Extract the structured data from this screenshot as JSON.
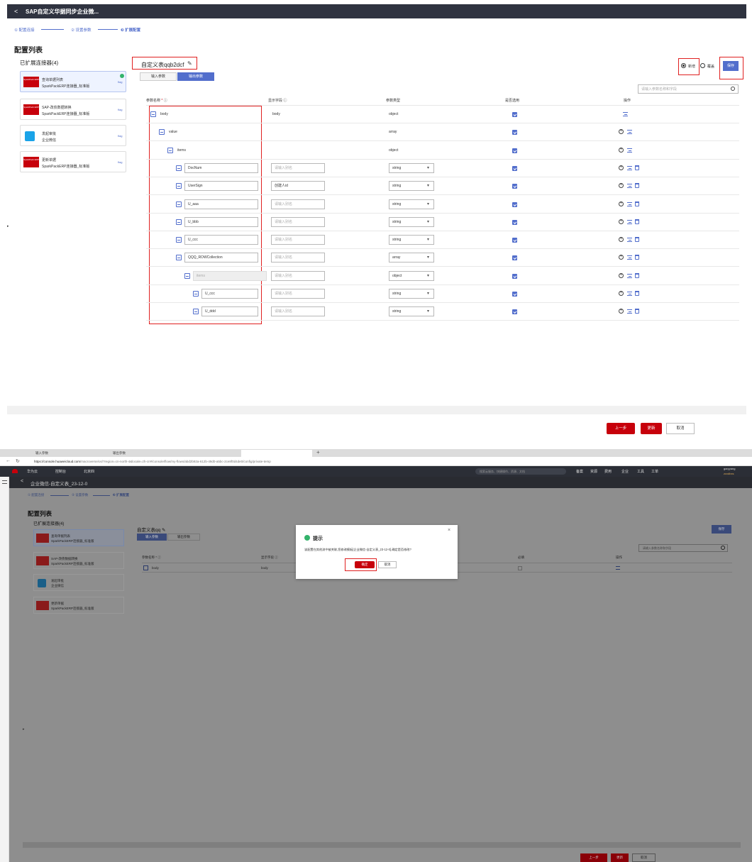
{
  "top": {
    "header": {
      "back": "<",
      "title": "SAP自定义华据同步企业微..."
    },
    "steps": [
      "① 配置连接",
      "② 设置参数",
      "❸ 扩展配置"
    ],
    "section_title": "配置列表",
    "connectors_title": "已扩展连接器(4)",
    "connectors": [
      {
        "name": "查询单据列表",
        "sub": "SparkPackERP连接器_标准版",
        "tag": "flag",
        "logo": "SparkPack ERP"
      },
      {
        "name": "SAP-改债数据转换",
        "sub": "SparkPackERP连接器_标准版",
        "tag": "flag",
        "logo": "SparkPack ERP"
      },
      {
        "name": "发起审批",
        "sub": "企业微信",
        "tag": "flag",
        "logo": ""
      },
      {
        "name": "更新单据",
        "sub": "SparkPackERP连接器_标准版",
        "tag": "flag",
        "logo": "SparkPack ERP"
      }
    ],
    "table_name": "自定义表qqb2dcf",
    "tabs": [
      "输入参数",
      "输出参数"
    ],
    "radio_new": "新增",
    "radio_cover": "覆盖",
    "save": "保存",
    "search_placeholder": "请输入参数名称和字段",
    "columns": [
      "参数名称",
      "显示字段",
      "参数类型",
      "是否选用",
      "操作"
    ],
    "rows": [
      {
        "name": "body",
        "display": "body",
        "type": "object"
      },
      {
        "name": "value",
        "display": "",
        "type": "array"
      },
      {
        "name": "items",
        "display": "",
        "type": "object"
      },
      {
        "name": "DocNum",
        "display": "请输入别名",
        "type": "string"
      },
      {
        "name": "UserSign",
        "display": "创建人id",
        "type": "string"
      },
      {
        "name": "U_aaa",
        "display": "请输入别名",
        "type": "string"
      },
      {
        "name": "U_bbb",
        "display": "请输入别名",
        "type": "string"
      },
      {
        "name": "U_ccc",
        "display": "请输入别名",
        "type": "string"
      },
      {
        "name": "QQQ_ROWCollection",
        "display": "请输入别名",
        "type": "array"
      },
      {
        "name": "items",
        "display": "请输入别名",
        "type": "object"
      },
      {
        "name": "U_ccc",
        "display": "请输入别名",
        "type": "string"
      },
      {
        "name": "U_ddd",
        "display": "请输入别名",
        "type": "string"
      }
    ],
    "footer": {
      "prev": "上一步",
      "update": "更新",
      "cancel": "取消"
    }
  },
  "bottom": {
    "tabs": [
      "输入参数",
      "输出参数"
    ],
    "url_prefix": "https://console.huaweicloud.com",
    "url": "/macroverse/os/?region=cn-north-4&locale=zh-cn#/console/flow/my-flows/abd2b92a-612b-49d0-a5bc-2ce8f0d4de0/config/private-temp",
    "nav": {
      "brand": "华为云",
      "console": "控制台",
      "region": "北京四",
      "search": "搜索云服务、快捷操作、资源、文档",
      "links": [
        "备案",
        "资源",
        "费用",
        "企业",
        "工具",
        "工单"
      ],
      "user": "garyyang",
      "user_sub": "zcxdbxs"
    },
    "header": {
      "back": "<",
      "title": "企业微信-自定义表_23-12-0"
    },
    "steps": [
      "① 配置连接",
      "② 设置参数",
      "❸ 扩展配置"
    ],
    "section_title": "配置列表",
    "connectors_title": "已扩展连接器(4)",
    "connectors": [
      {
        "name": "查询单据列表",
        "sub": "SparkPackERP连接器_标准版"
      },
      {
        "name": "SAP-改债数据转换",
        "sub": "SparkPackERP连接器_标准版"
      },
      {
        "name": "发起审批",
        "sub": "企业微信"
      },
      {
        "name": "更新单据",
        "sub": "SparkPackERP连接器_标准版"
      }
    ],
    "table_name": "自定义表qq",
    "save": "保存",
    "search_placeholder": "请输入参数名称和字段",
    "columns": [
      "参数名称",
      "显示字段",
      "必填",
      "操作"
    ],
    "row": {
      "name": "body",
      "display": "body",
      "type": "object"
    },
    "dialog": {
      "title": "提示",
      "message": "该配置在其他流中被关联,您修改模板[企业微信-自定义表_23-12-0],确定是否修改?",
      "ok": "确定",
      "cancel": "取消",
      "close": "×"
    },
    "footer": {
      "prev": "上一步",
      "update": "更新",
      "cancel": "取消"
    }
  },
  "colors": {
    "accent": "#526ecc",
    "brand_red": "#c7000b",
    "highlight": "#e02020"
  }
}
